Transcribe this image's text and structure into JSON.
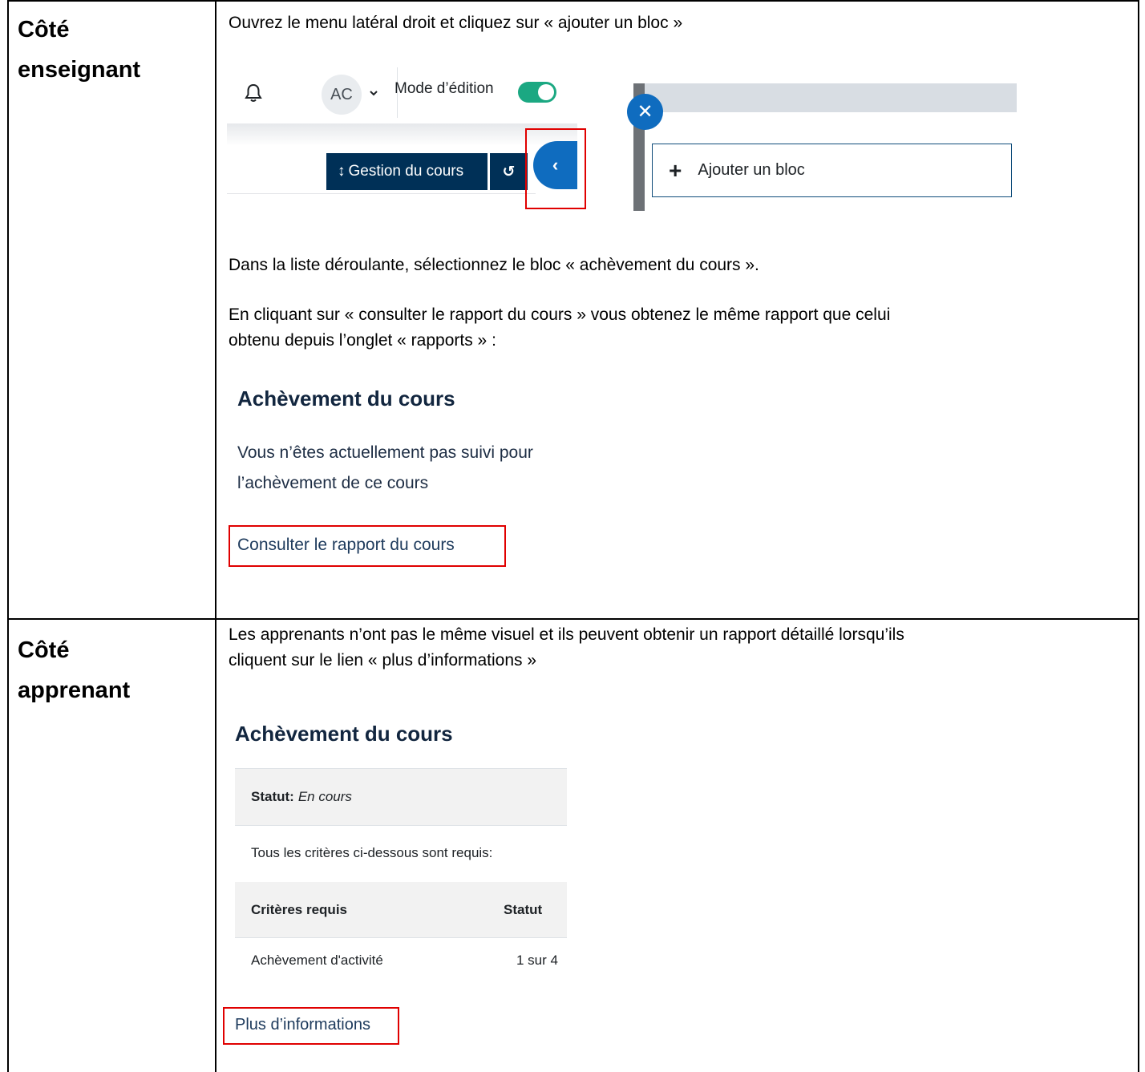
{
  "teacher": {
    "label_line1": "Côté",
    "label_line2": "enseignant",
    "intro": "Ouvrez le menu latéral droit et cliquez sur « ajouter un bloc »",
    "toolbar": {
      "avatar_initials": "AC",
      "edit_mode_label": "Mode d’édition",
      "edit_mode_on": true,
      "course_management_label": "Gestion du cours"
    },
    "drawer": {
      "add_block_label": "Ajouter un bloc"
    },
    "step2": "Dans la liste déroulante, sélectionnez le bloc « achèvement du cours ».",
    "step3_line1": "En cliquant sur « consulter le rapport du cours » vous obtenez le même rapport que celui",
    "step3_line2": "obtenu depuis l’onglet « rapports » :",
    "block": {
      "title": "Achèvement du cours",
      "message_line1": "Vous n’êtes actuellement pas suivi pour",
      "message_line2": "l’achèvement de ce cours",
      "report_link": "Consulter le rapport du cours"
    }
  },
  "learner": {
    "label_line1": "Côté",
    "label_line2": "apprenant",
    "intro_line1": "Les apprenants n’ont pas le même visuel et ils peuvent obtenir un rapport détaillé lorsqu’ils",
    "intro_line2": "cliquent sur le lien « plus d’informations »",
    "block": {
      "title": "Achèvement du cours",
      "status_label": "Statut:",
      "status_value": "En cours",
      "criteria_note": "Tous les critères ci-dessous sont requis:",
      "col_criteria": "Critères requis",
      "col_status": "Statut",
      "row_criteria": "Achèvement d'activité",
      "row_status": "1 sur 4",
      "more_info_link": "Plus d’informations"
    }
  },
  "colors": {
    "highlight": "#e00000",
    "moodle_blue": "#0f6cbf",
    "dark_navy": "#003057",
    "toggle_green": "#1ba882"
  }
}
